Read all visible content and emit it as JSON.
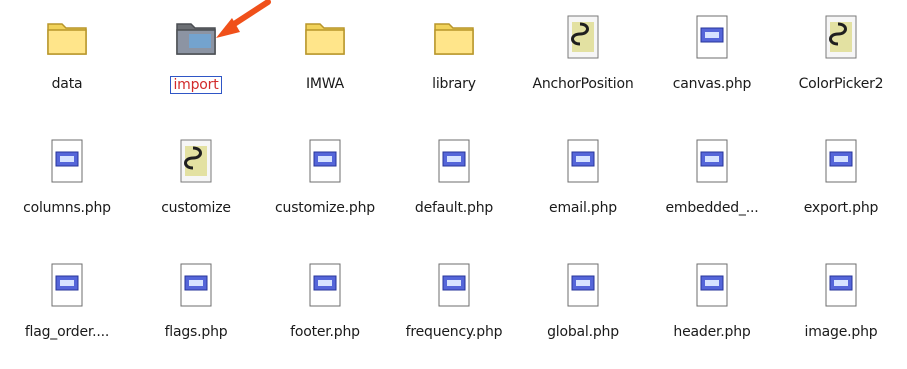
{
  "items": [
    {
      "label": "data",
      "type": "folder"
    },
    {
      "label": "import",
      "type": "folder-dark",
      "selected": true
    },
    {
      "label": "IMWA",
      "type": "folder"
    },
    {
      "label": "library",
      "type": "folder"
    },
    {
      "label": "AnchorPosition",
      "type": "script"
    },
    {
      "label": "canvas.php",
      "type": "php"
    },
    {
      "label": "ColorPicker2",
      "type": "script"
    },
    {
      "label": "columns.php",
      "type": "php"
    },
    {
      "label": "customize",
      "type": "script"
    },
    {
      "label": "customize.php",
      "type": "php"
    },
    {
      "label": "default.php",
      "type": "php"
    },
    {
      "label": "email.php",
      "type": "php"
    },
    {
      "label": "embedded_...",
      "type": "php"
    },
    {
      "label": "export.php",
      "type": "php"
    },
    {
      "label": "flag_order....",
      "type": "php"
    },
    {
      "label": "flags.php",
      "type": "php"
    },
    {
      "label": "footer.php",
      "type": "php"
    },
    {
      "label": "frequency.php",
      "type": "php"
    },
    {
      "label": "global.php",
      "type": "php"
    },
    {
      "label": "header.php",
      "type": "php"
    },
    {
      "label": "image.php",
      "type": "php"
    }
  ],
  "colors": {
    "selection_border": "#2f56c6",
    "selection_text": "#d22a2a",
    "arrow": "#f0501a"
  }
}
